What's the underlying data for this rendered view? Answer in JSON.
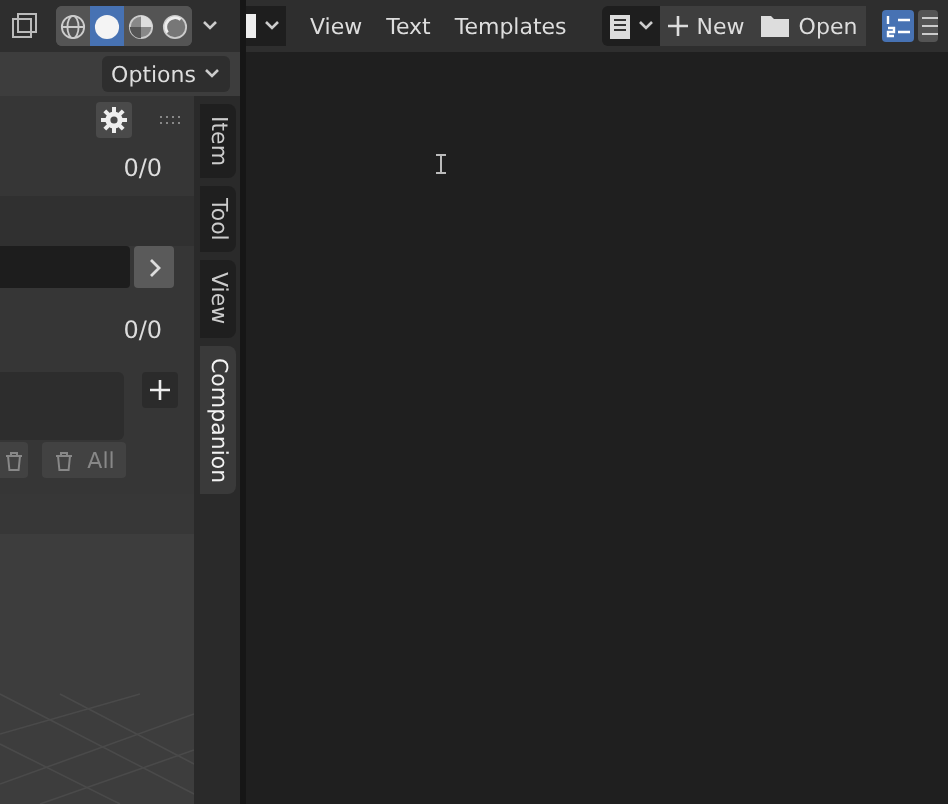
{
  "viewport_header": {
    "shading_modes": [
      {
        "kind": "wireframe",
        "selected": false
      },
      {
        "kind": "solid",
        "selected": true
      },
      {
        "kind": "material",
        "selected": false
      },
      {
        "kind": "rendered",
        "selected": false
      }
    ]
  },
  "options_button": "Options",
  "sidebar_panel": {
    "count_1": "0/0",
    "count_2": "0/0",
    "delete_all_button": "All"
  },
  "sidebar_tabs": [
    {
      "label": "Item",
      "selected": false
    },
    {
      "label": "Tool",
      "selected": false
    },
    {
      "label": "View",
      "selected": false
    },
    {
      "label": "Companion",
      "selected": true
    }
  ],
  "text_editor_header": {
    "menus": [
      "View",
      "Text",
      "Templates"
    ],
    "new_button": "New",
    "open_button": "Open"
  }
}
